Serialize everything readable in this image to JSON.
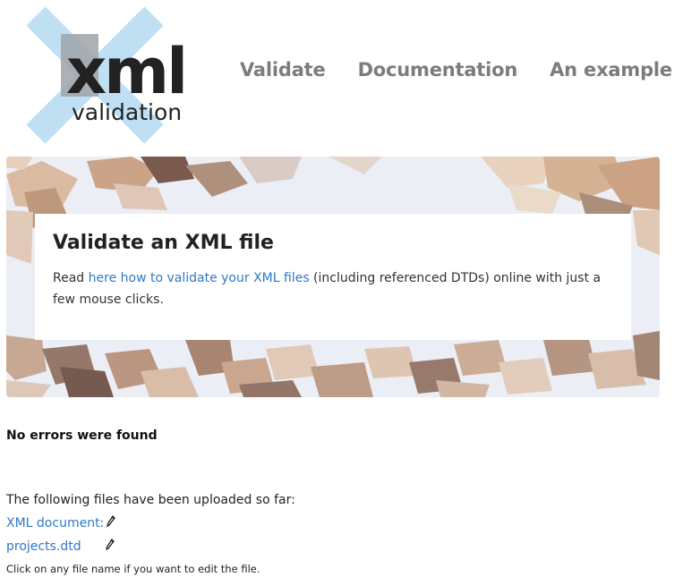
{
  "logo": {
    "word": "xml",
    "subword": "validation"
  },
  "nav": {
    "items": [
      "Validate",
      "Documentation",
      "An example"
    ]
  },
  "hero": {
    "title": "Validate an XML file",
    "text_before": "Read ",
    "link_text": "here how to validate your XML files",
    "text_after": " (including referenced DTDs) online with just a few mouse clicks."
  },
  "status": "No errors were found",
  "files": {
    "intro": "The following files have been uploaded so far:",
    "items": [
      {
        "label": "XML document:",
        "icon": "pencil-icon"
      },
      {
        "label": "projects.dtd",
        "icon": "pencil-icon"
      }
    ],
    "hint": "Click on any file name if you want to edit the file."
  },
  "colors": {
    "link": "#2f79c7",
    "nav": "#7c7c7c",
    "logo_x": "#bfe0f3",
    "logo_text": "#222222"
  }
}
